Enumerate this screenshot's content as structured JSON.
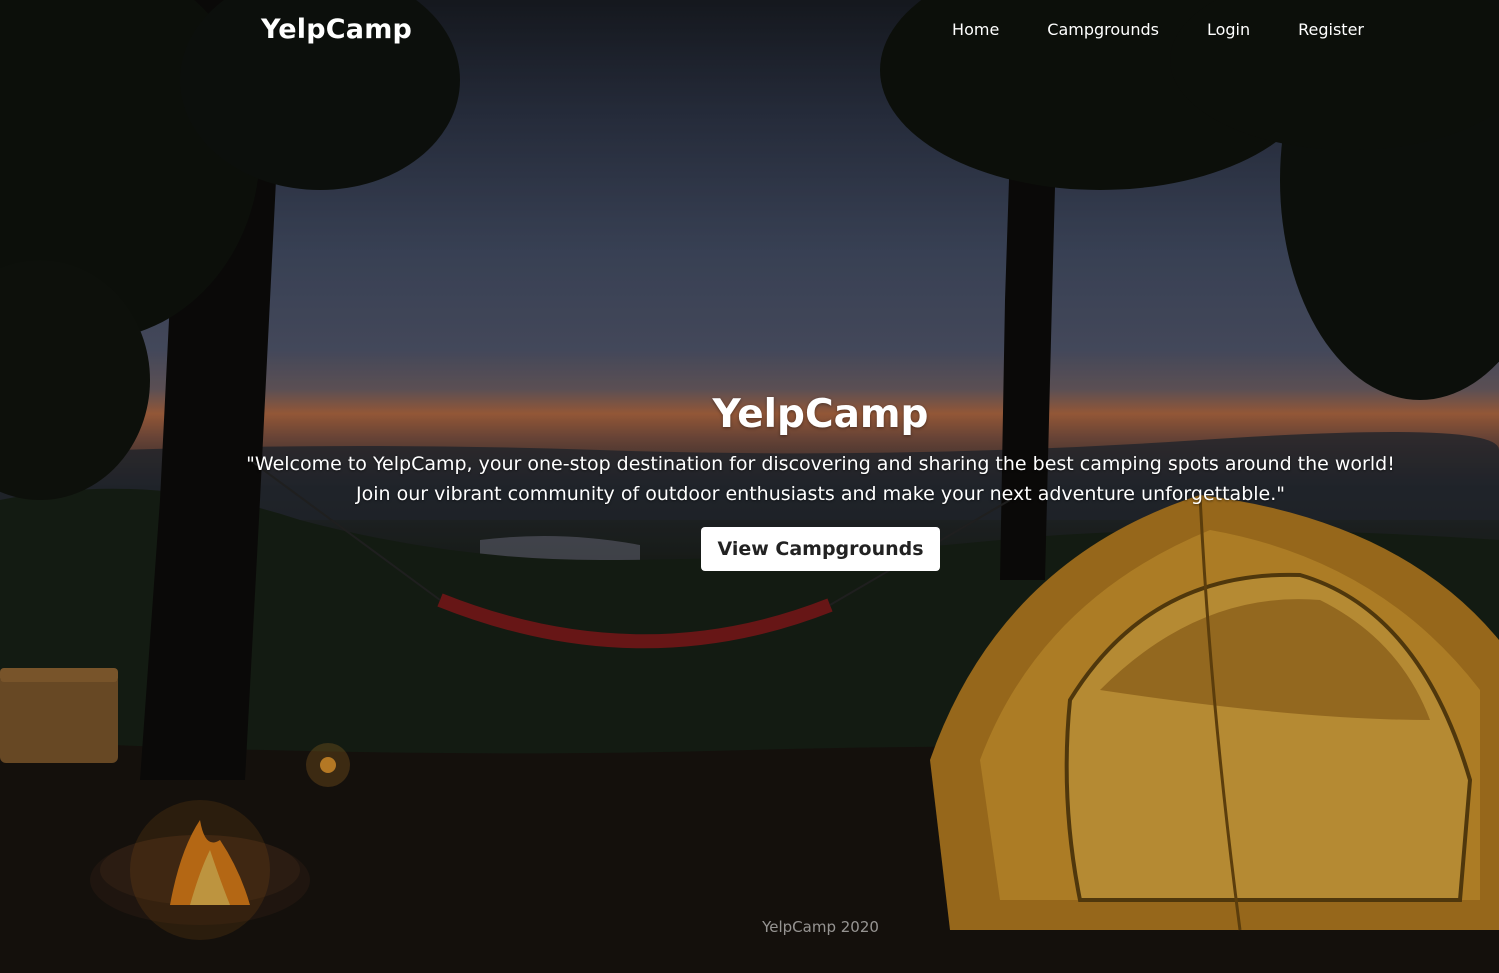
{
  "nav": {
    "brand": "YelpCamp",
    "links": [
      "Home",
      "Campgrounds",
      "Login",
      "Register"
    ]
  },
  "hero": {
    "title": "YelpCamp",
    "lead_line1": "\"Welcome to YelpCamp, your one-stop destination for discovering and sharing the best camping spots around the world!",
    "lead_line2": "Join our vibrant community of outdoor enthusiasts and make your next adventure unforgettable.\"",
    "button_label": "View Campgrounds"
  },
  "footer": {
    "text": "YelpCamp 2020"
  },
  "colors": {
    "overlay": "#000000",
    "button_bg": "#ffffff",
    "button_text": "#222222",
    "tent": "#e6a632",
    "fire": "#f08a1c",
    "sunset": "#c4744a"
  }
}
